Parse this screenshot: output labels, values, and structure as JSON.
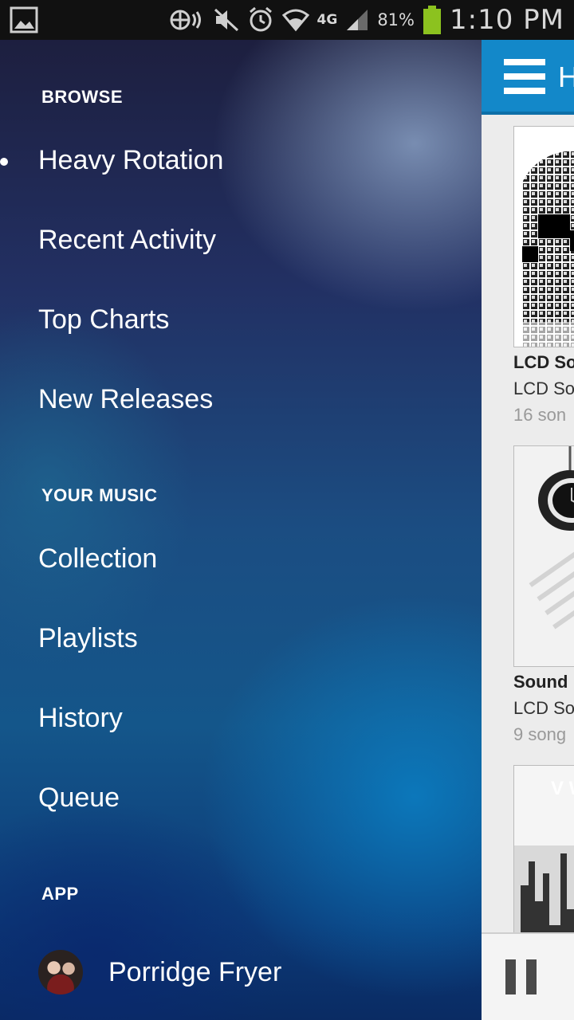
{
  "status_bar": {
    "icons": [
      "image-notification-icon",
      "nfc-icon",
      "mute-icon",
      "alarm-icon",
      "wifi-icon",
      "signal-icon",
      "battery-icon"
    ],
    "network": "4G",
    "battery_percent": "81%",
    "battery_level": 0.81,
    "time": "1:10 PM"
  },
  "drawer": {
    "sections": [
      {
        "header": "BROWSE",
        "items": [
          "Heavy Rotation",
          "Recent Activity",
          "Top Charts",
          "New Releases"
        ]
      },
      {
        "header": "YOUR MUSIC",
        "items": [
          "Collection",
          "Playlists",
          "History",
          "Queue"
        ]
      },
      {
        "header": "APP"
      }
    ],
    "active_item": "Heavy Rotation",
    "profile": {
      "name": "Porridge Fryer"
    }
  },
  "content": {
    "app_bar": {
      "menu_icon": "hamburger-icon",
      "title_peek": "H"
    },
    "albums": [
      {
        "title": "LCD So",
        "artist": "LCD So",
        "count": "16 son"
      },
      {
        "title": "Sound",
        "artist": "LCD So",
        "count": "9 song"
      },
      {
        "art_text": "V W"
      }
    ],
    "player": {
      "icon": "pause-icon"
    }
  },
  "colors": {
    "accent": "#1388c9",
    "status_bar": "#111111",
    "battery": "#8cc21f"
  }
}
